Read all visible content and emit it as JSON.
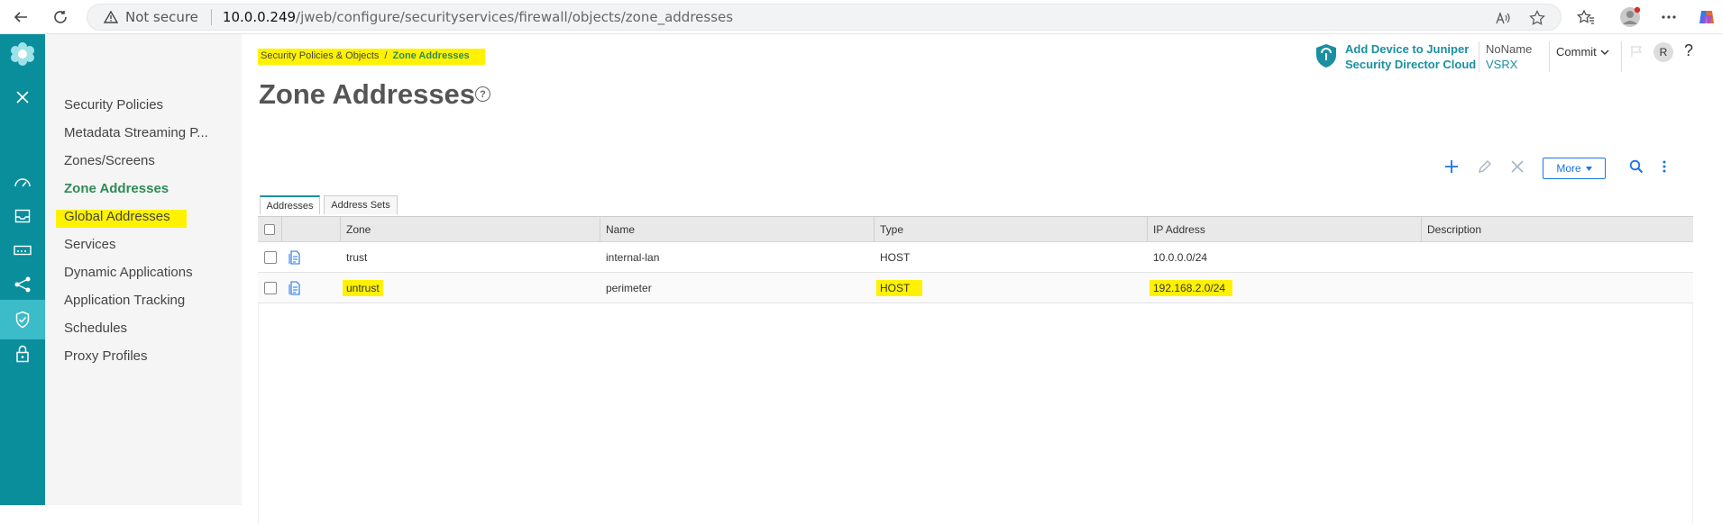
{
  "browser": {
    "security_label": "Not secure",
    "url_host": "10.0.0.249",
    "url_path": "/jweb/configure/securityservices/firewall/objects/zone_addresses"
  },
  "rail": {
    "items": [
      "logo-icon",
      "close-icon",
      "dashboard-icon",
      "monitor-icon",
      "device-icon",
      "network-icon",
      "security-icon",
      "lock-icon"
    ],
    "active_index": 6
  },
  "nav": {
    "items": [
      {
        "label": "Security Policies"
      },
      {
        "label": "Metadata Streaming P..."
      },
      {
        "label": "Zones/Screens"
      },
      {
        "label": "Zone Addresses"
      },
      {
        "label": "Global Addresses"
      },
      {
        "label": "Services"
      },
      {
        "label": "Dynamic Applications"
      },
      {
        "label": "Application Tracking"
      },
      {
        "label": "Schedules"
      },
      {
        "label": "Proxy Profiles"
      }
    ],
    "active_index": 3
  },
  "breadcrumb": {
    "parent": "Security Policies & Objects",
    "separator": "/",
    "current": "Zone Addresses"
  },
  "page": {
    "title": "Zone Addresses",
    "help": "?"
  },
  "header": {
    "sdc_line1": "Add Device to Juniper",
    "sdc_line2": "Security Director Cloud",
    "device_name": "NoName",
    "device_model": "VSRX",
    "commit_label": "Commit",
    "avatar_initial": "R",
    "help_label": "?"
  },
  "toolbar": {
    "more_label": "More"
  },
  "tabs": [
    {
      "label": "Addresses"
    },
    {
      "label": "Address Sets"
    }
  ],
  "grid": {
    "columns": [
      "Zone",
      "Name",
      "Type",
      "IP Address",
      "Description"
    ],
    "rows": [
      {
        "zone": "trust",
        "name": "internal-lan",
        "type": "HOST",
        "ip": "10.0.0.0/24",
        "description": ""
      },
      {
        "zone": "untrust",
        "name": "perimeter",
        "type": "HOST",
        "ip": "192.168.2.0/24",
        "description": ""
      }
    ]
  },
  "colors": {
    "rail": "#0a8e9c",
    "rail_active": "#3bbcc8",
    "accent": "#1a8fa0",
    "active_nav": "#2e8b57",
    "highlight": "#fff200"
  }
}
